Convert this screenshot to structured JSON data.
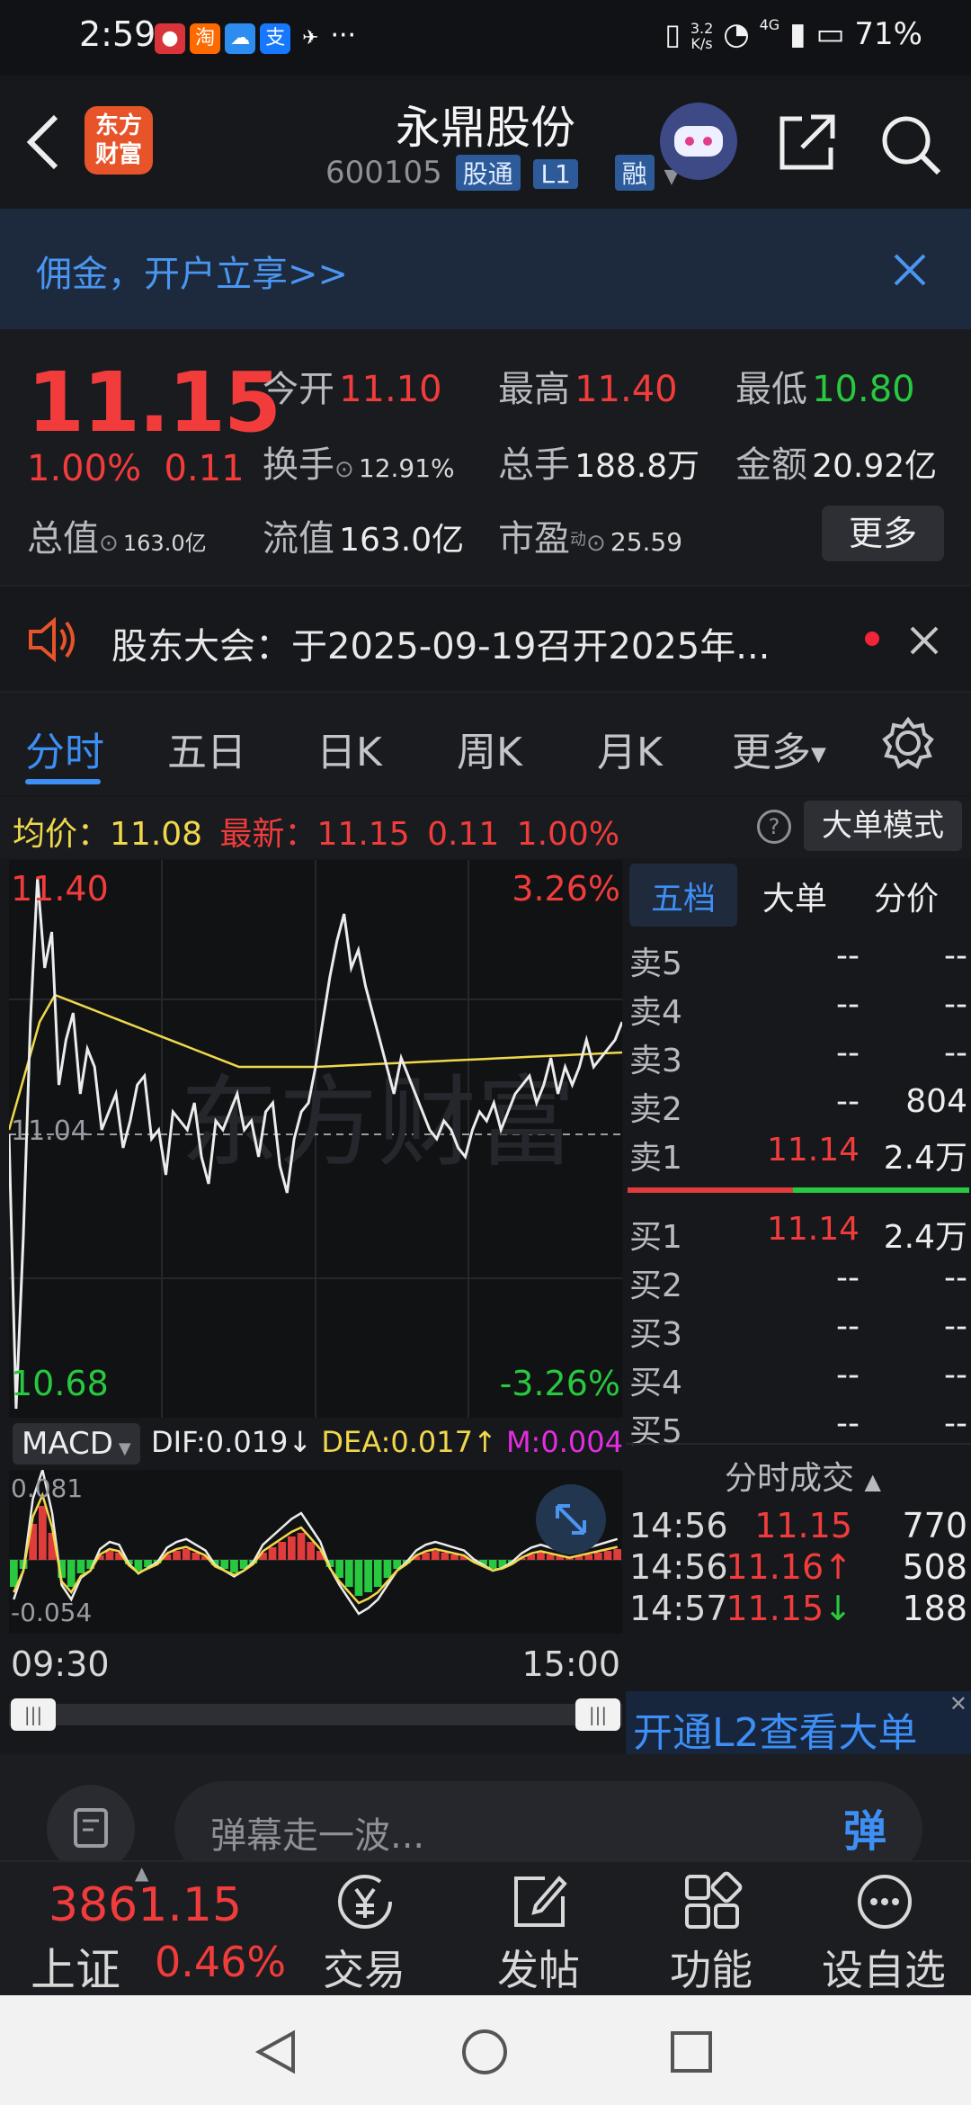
{
  "status_bar": {
    "time": "2:59",
    "net_speed_value": "3.2",
    "net_speed_unit": "K/s",
    "signal": "4G",
    "battery": "71%"
  },
  "header": {
    "logo_line1": "东方",
    "logo_line2": "财富",
    "title": "永鼎股份",
    "code": "600105",
    "tag1": "股通",
    "tag2": "L1",
    "tag3": "融"
  },
  "banner": {
    "text": "佣金，开户立享>>"
  },
  "quote": {
    "price": "11.15",
    "change_pct": "1.00%",
    "change_amt": "0.11",
    "labels": {
      "open": "今开",
      "high": "最高",
      "low": "最低",
      "turnover": "换手",
      "volume": "总手",
      "amount": "金额",
      "market_cap": "总值",
      "float_cap": "流值",
      "pe": "市盈",
      "pe_sup": "动"
    },
    "open": "11.10",
    "high": "11.40",
    "low": "10.80",
    "turnover": "12.91%",
    "volume": "188.8万",
    "amount": "20.92亿",
    "market_cap": "163.0亿",
    "float_cap": "163.0亿",
    "pe": "25.59",
    "more": "更多"
  },
  "notice": {
    "text": "股东大会：于2025-09-19召开2025年..."
  },
  "tabs": [
    "分时",
    "五日",
    "日K",
    "周K",
    "月K",
    "更多"
  ],
  "infobar": {
    "avg_label": "均价：",
    "avg": "11.08",
    "latest_label": "最新：",
    "latest": "11.15",
    "chg": "0.11",
    "pct": "1.00%",
    "mode_btn": "大单模式"
  },
  "chart": {
    "max_price": "11.40",
    "max_pct": "3.26%",
    "min_price": "10.68",
    "min_pct": "-3.26%",
    "prev_close": "11.04",
    "watermark": "东方财富",
    "start_time": "09:30",
    "end_time": "15:00"
  },
  "macd": {
    "selector": "MACD",
    "dif": "DIF:0.019",
    "dea": "DEA:0.017",
    "m": "M:0.004",
    "top": "0.081",
    "bottom": "-0.054"
  },
  "book": {
    "tabs": [
      "五档",
      "大单",
      "分价"
    ],
    "asks": [
      {
        "label": "卖5",
        "price": "--",
        "vol": "--"
      },
      {
        "label": "卖4",
        "price": "--",
        "vol": "--"
      },
      {
        "label": "卖3",
        "price": "--",
        "vol": "--"
      },
      {
        "label": "卖2",
        "price": "--",
        "vol": "804"
      },
      {
        "label": "卖1",
        "price": "11.14",
        "vol": "2.4万"
      }
    ],
    "bids": [
      {
        "label": "买1",
        "price": "11.14",
        "vol": "2.4万"
      },
      {
        "label": "买2",
        "price": "--",
        "vol": "--"
      },
      {
        "label": "买3",
        "price": "--",
        "vol": "--"
      },
      {
        "label": "买4",
        "price": "--",
        "vol": "--"
      },
      {
        "label": "买5",
        "price": "--",
        "vol": "--"
      }
    ],
    "trades_title": "分时成交",
    "trades": [
      {
        "time": "14:56",
        "price": "11.15",
        "arrow": "",
        "vol": "770"
      },
      {
        "time": "14:56",
        "price": "11.16",
        "arrow": "↑",
        "vol": "508"
      },
      {
        "time": "14:57",
        "price": "11.15",
        "arrow": "↓",
        "vol": "188"
      }
    ],
    "l2": "开通L2查看大单"
  },
  "danmu": {
    "placeholder": "弹幕走一波...",
    "btn": "弹"
  },
  "bottomnav": {
    "index_value": "3861.15",
    "index_name": "上证",
    "index_pct": "0.46%",
    "items": [
      "交易",
      "发帖",
      "功能",
      "设自选"
    ]
  },
  "colors": {
    "up": "#f23c3c",
    "down": "#28c841",
    "accent": "#3d8ff5",
    "avg_line": "#f0d84a"
  }
}
